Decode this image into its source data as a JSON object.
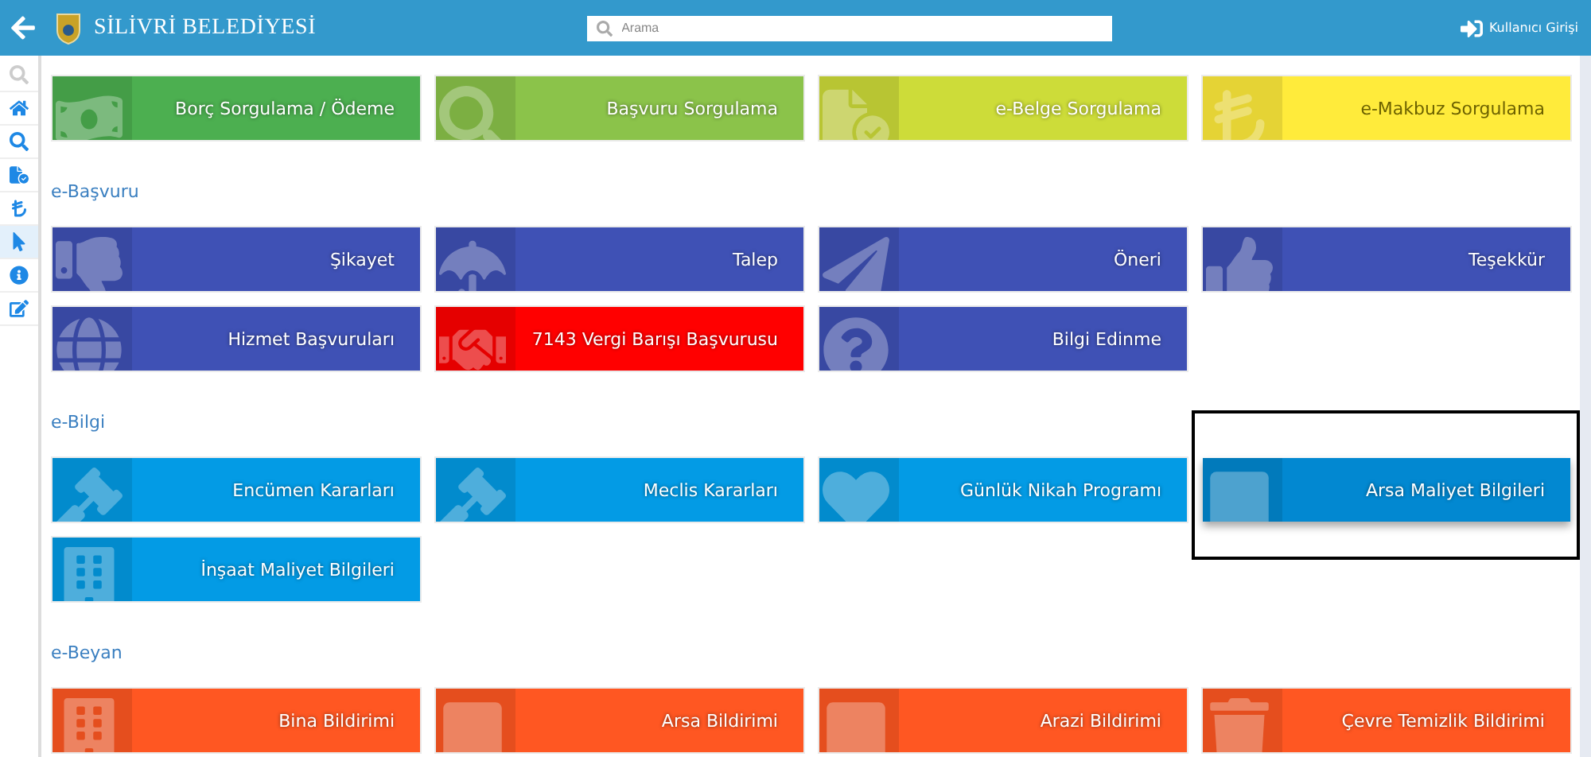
{
  "header": {
    "title": "SİLİVRİ BELEDİYESİ",
    "search": {
      "placeholder": "Arama"
    },
    "login": "Kullanıcı Girişi"
  },
  "sidebar": {
    "items": [
      {
        "selected": false,
        "disabled": true
      },
      {
        "selected": false,
        "disabled": false
      },
      {
        "selected": false,
        "disabled": false
      },
      {
        "selected": false,
        "disabled": false
      },
      {
        "selected": false,
        "disabled": false
      },
      {
        "selected": true,
        "disabled": false
      },
      {
        "selected": false,
        "disabled": false
      },
      {
        "selected": false,
        "disabled": false
      }
    ]
  },
  "sections": [
    {
      "tiles": [
        {
          "label": "Borç Sorgulama / Ödeme",
          "color": "#4caf50",
          "highlighted": false
        },
        {
          "label": "Başvuru Sorgulama",
          "color": "#8bc34a",
          "highlighted": false
        },
        {
          "label": "e-Belge Sorgulama",
          "color": "#cddc39",
          "highlighted": false
        },
        {
          "label": "e-Makbuz Sorgulama",
          "color": "#ffeb3b",
          "highlighted": false
        }
      ]
    },
    {
      "title": "e-Başvuru",
      "tiles": [
        {
          "label": "Şikayet",
          "color": "#3f51b5",
          "highlighted": false
        },
        {
          "label": "Talep",
          "color": "#3f51b5",
          "highlighted": false
        },
        {
          "label": "Öneri",
          "color": "#3f51b5",
          "highlighted": false
        },
        {
          "label": "Teşekkür",
          "color": "#3f51b5",
          "highlighted": false
        },
        {
          "label": "Hizmet Başvuruları",
          "color": "#3f51b5",
          "highlighted": false
        },
        {
          "label": "7143 Vergi Barışı Başvurusu",
          "color": "#ff0000",
          "highlighted": false
        },
        {
          "label": "Bilgi Edinme",
          "color": "#3f51b5",
          "highlighted": false
        }
      ]
    },
    {
      "title": "e-Bilgi",
      "tiles": [
        {
          "label": "Encümen Kararları",
          "color": "#039be5",
          "highlighted": false
        },
        {
          "label": "Meclis Kararları",
          "color": "#039be5",
          "highlighted": false
        },
        {
          "label": "Günlük Nikah Programı",
          "color": "#039be5",
          "highlighted": false
        },
        {
          "label": "Arsa Maliyet Bilgileri",
          "color": "#0288d1",
          "highlighted": true
        },
        {
          "label": "İnşaat Maliyet Bilgileri",
          "color": "#039be5",
          "highlighted": false
        }
      ]
    },
    {
      "title": "e-Beyan",
      "tiles": [
        {
          "label": "Bina Bildirimi",
          "color": "#ff5722",
          "highlighted": false
        },
        {
          "label": "Arsa Bildirimi",
          "color": "#ff5722",
          "highlighted": false
        },
        {
          "label": "Arazi Bildirimi",
          "color": "#ff5722",
          "highlighted": false
        },
        {
          "label": "Çevre Temizlik Bildirimi",
          "color": "#ff5722",
          "highlighted": false
        }
      ]
    }
  ]
}
